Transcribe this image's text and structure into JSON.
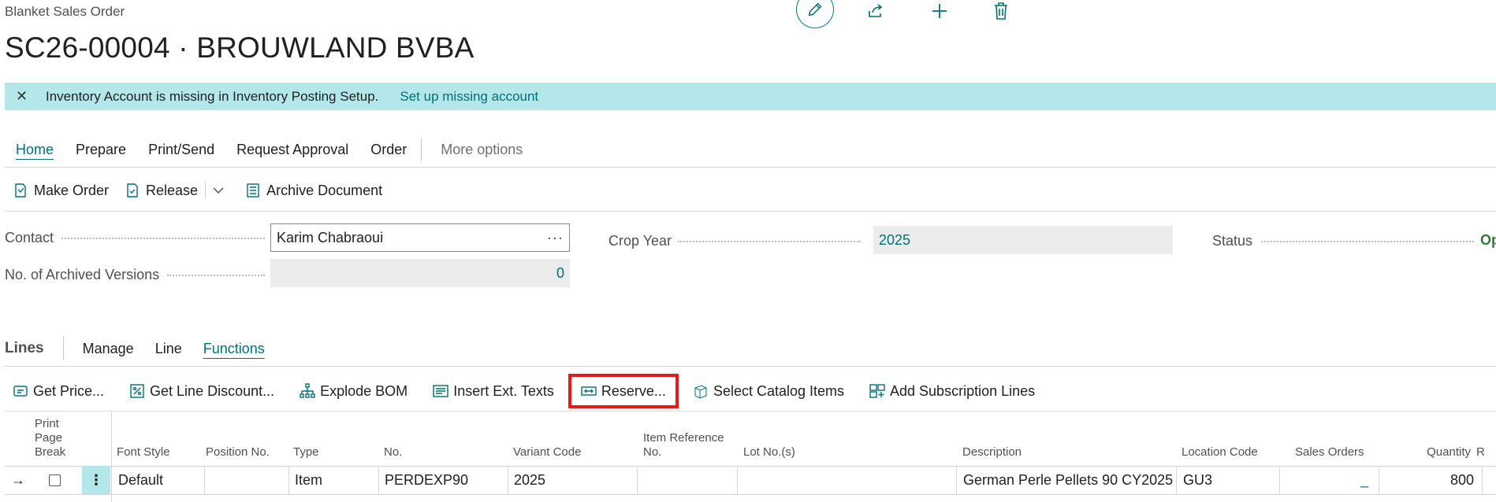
{
  "page": {
    "caption": "Blanket Sales Order",
    "title": "SC26-00004 · BROUWLAND BVBA"
  },
  "banner": {
    "message": "Inventory Account is missing in Inventory Posting Setup.",
    "link": "Set up missing account"
  },
  "menu": {
    "tabs": [
      "Home",
      "Prepare",
      "Print/Send",
      "Request Approval",
      "Order"
    ],
    "more": "More options"
  },
  "actions": {
    "make_order": "Make Order",
    "release": "Release",
    "archive": "Archive Document"
  },
  "fields": {
    "contact_label": "Contact",
    "contact_value": "Karim Chabraoui",
    "contact_ellipsis": "···",
    "archived_label": "No. of Archived Versions",
    "archived_value": "0",
    "crop_label": "Crop Year",
    "crop_value": "2025",
    "status_label": "Status",
    "status_value": "Op"
  },
  "lines": {
    "label": "Lines",
    "tabs": [
      "Manage",
      "Line",
      "Functions"
    ]
  },
  "functions": {
    "get_price": "Get Price...",
    "get_line_discount": "Get Line Discount...",
    "explode_bom": "Explode BOM",
    "insert_ext_texts": "Insert Ext. Texts",
    "reserve": "Reserve...",
    "select_catalog": "Select Catalog Items",
    "add_subscription": "Add Subscription Lines"
  },
  "table": {
    "headers": {
      "print_page_break": "Print Page Break",
      "font_style": "Font Style",
      "position_no": "Position No.",
      "type": "Type",
      "no": "No.",
      "variant_code": "Variant Code",
      "item_reference_no": "Item Reference No.",
      "lot_nos": "Lot No.(s)",
      "description": "Description",
      "location_code": "Location Code",
      "sales_orders": "Sales Orders",
      "quantity": "Quantity",
      "r": "R"
    },
    "row": {
      "arrow": "→",
      "menu": "⋮",
      "font_style": "Default",
      "type": "Item",
      "no": "PERDEXP90",
      "variant_code": "2025",
      "description": "German Perle Pellets 90 CY2025",
      "location_code": "GU3",
      "sales_orders": "_",
      "quantity": "800"
    }
  },
  "colors": {
    "accent": "#00707a",
    "banner": "#b4e7e9",
    "highlight": "#e31b1b",
    "status": "#2e7d32"
  }
}
